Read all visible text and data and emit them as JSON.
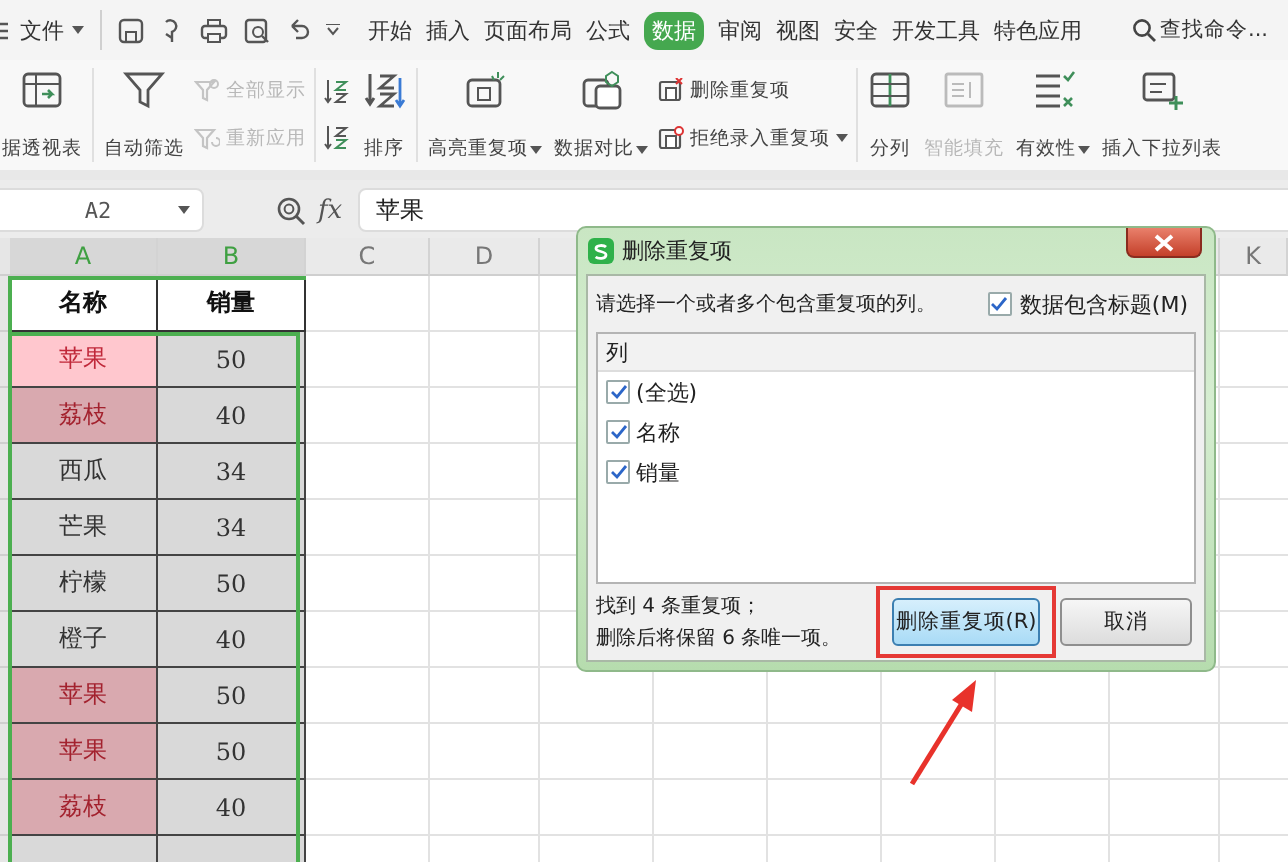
{
  "menu": {
    "file": "文件",
    "tabs": [
      {
        "label": "开始",
        "selected": false
      },
      {
        "label": "插入",
        "selected": false
      },
      {
        "label": "页面布局",
        "selected": false
      },
      {
        "label": "公式",
        "selected": false
      },
      {
        "label": "数据",
        "selected": true
      },
      {
        "label": "审阅",
        "selected": false
      },
      {
        "label": "视图",
        "selected": false
      },
      {
        "label": "安全",
        "selected": false
      },
      {
        "label": "开发工具",
        "selected": false
      },
      {
        "label": "特色应用",
        "selected": false
      }
    ],
    "search": {
      "placeholder": "查找命令..."
    }
  },
  "ribbon": {
    "groups": [
      [
        {
          "kind": "large",
          "label": "据透视表",
          "dropdown": false,
          "disabled": false
        }
      ],
      [
        {
          "kind": "large",
          "label": "自动筛选",
          "dropdown": false,
          "disabled": false
        },
        {
          "kind": "stack",
          "items": [
            {
              "label": "全部显示",
              "dropdown": false,
              "disabled": true
            },
            {
              "label": "重新应用",
              "dropdown": false,
              "disabled": true
            }
          ]
        }
      ],
      [
        {
          "kind": "icon_stack"
        },
        {
          "kind": "large",
          "label": "排序",
          "dropdown": false,
          "disabled": false
        }
      ],
      [
        {
          "kind": "large",
          "label": "高亮重复项",
          "dropdown": true,
          "disabled": false
        },
        {
          "kind": "large",
          "label": "数据对比",
          "dropdown": true,
          "disabled": false
        },
        {
          "kind": "stack",
          "items": [
            {
              "label": "删除重复项",
              "dropdown": false,
              "disabled": false
            },
            {
              "label": "拒绝录入重复项",
              "dropdown": true,
              "disabled": false
            }
          ]
        }
      ],
      [
        {
          "kind": "large",
          "label": "分列",
          "dropdown": false,
          "disabled": false
        },
        {
          "kind": "large",
          "label": "智能填充",
          "dropdown": false,
          "disabled": true
        },
        {
          "kind": "large",
          "label": "有效性",
          "dropdown": true,
          "disabled": false
        },
        {
          "kind": "large",
          "label": "插入下拉列表",
          "dropdown": false,
          "disabled": false
        }
      ]
    ]
  },
  "formula_bar": {
    "cell": "A2",
    "function_label": "fx",
    "value": "苹果"
  },
  "sheet": {
    "columns": [
      {
        "label": "A",
        "selected": true
      },
      {
        "label": "B",
        "selected": true
      },
      {
        "label": "C",
        "selected": false
      },
      {
        "label": "D",
        "selected": false
      },
      {
        "label": "K",
        "selected": false
      }
    ],
    "header": [
      "名称",
      "销量"
    ],
    "rows": [
      {
        "name": "苹果",
        "sales": "50",
        "duplicate": true,
        "active": true
      },
      {
        "name": "荔枝",
        "sales": "40",
        "duplicate": true,
        "active": false
      },
      {
        "name": "西瓜",
        "sales": "34",
        "duplicate": false,
        "active": false
      },
      {
        "name": "芒果",
        "sales": "34",
        "duplicate": false,
        "active": false
      },
      {
        "name": "柠檬",
        "sales": "50",
        "duplicate": false,
        "active": false
      },
      {
        "name": "橙子",
        "sales": "40",
        "duplicate": false,
        "active": false
      },
      {
        "name": "苹果",
        "sales": "50",
        "duplicate": true,
        "active": false
      },
      {
        "name": "苹果",
        "sales": "50",
        "duplicate": true,
        "active": false
      },
      {
        "name": "荔枝",
        "sales": "40",
        "duplicate": true,
        "active": false
      }
    ]
  },
  "dialog": {
    "title": "删除重复项",
    "prompt": "请选择一个或者多个包含重复项的列。",
    "has_headers": {
      "label": "数据包含标题(M)",
      "checked": true
    },
    "list_header": "列",
    "items": [
      {
        "label": "(全选)",
        "checked": true
      },
      {
        "label": "名称",
        "checked": true
      },
      {
        "label": "销量",
        "checked": true
      }
    ],
    "summary": [
      "找到 4 条重复项；",
      "删除后将保留 6 条唯一项。"
    ],
    "buttons": [
      {
        "label": "删除重复项(R)",
        "kind": "primary",
        "highlighted": true
      },
      {
        "label": "取消",
        "kind": "normal",
        "highlighted": false
      }
    ]
  }
}
